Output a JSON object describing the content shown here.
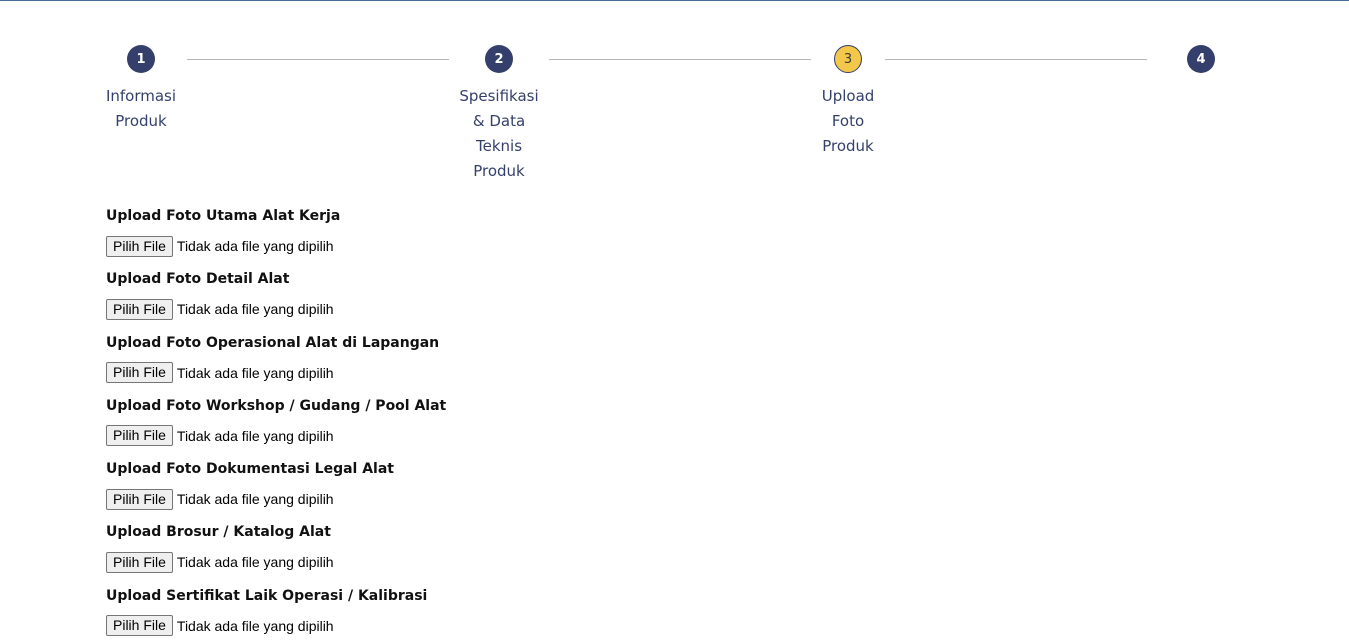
{
  "stepper": {
    "steps": [
      {
        "number": "1",
        "label": "Informasi\nProduk",
        "state": "done"
      },
      {
        "number": "2",
        "label": "Spesifikasi\n& Data\nTeknis\nProduk",
        "state": "done"
      },
      {
        "number": "3",
        "label": "Upload\nFoto\nProduk",
        "state": "active"
      },
      {
        "number": "4",
        "label": "",
        "state": "pending"
      }
    ],
    "colors": {
      "step_default": "#343f6b",
      "step_active": "#f3c74a",
      "connector": "#b5b5b5"
    }
  },
  "uploads": [
    {
      "label": "Upload Foto Utama Alat Kerja",
      "button": "Pilih File",
      "status": "Tidak ada file yang dipilih"
    },
    {
      "label": "Upload Foto Detail Alat",
      "button": "Pilih File",
      "status": "Tidak ada file yang dipilih"
    },
    {
      "label": "Upload Foto Operasional Alat di Lapangan",
      "button": "Pilih File",
      "status": "Tidak ada file yang dipilih"
    },
    {
      "label": "Upload Foto Workshop / Gudang / Pool Alat",
      "button": "Pilih File",
      "status": "Tidak ada file yang dipilih"
    },
    {
      "label": "Upload Foto Dokumentasi Legal Alat",
      "button": "Pilih File",
      "status": "Tidak ada file yang dipilih"
    },
    {
      "label": "Upload Brosur / Katalog Alat",
      "button": "Pilih File",
      "status": "Tidak ada file yang dipilih"
    },
    {
      "label": "Upload Sertifikat Laik Operasi / Kalibrasi",
      "button": "Pilih File",
      "status": "Tidak ada file yang dipilih"
    }
  ]
}
